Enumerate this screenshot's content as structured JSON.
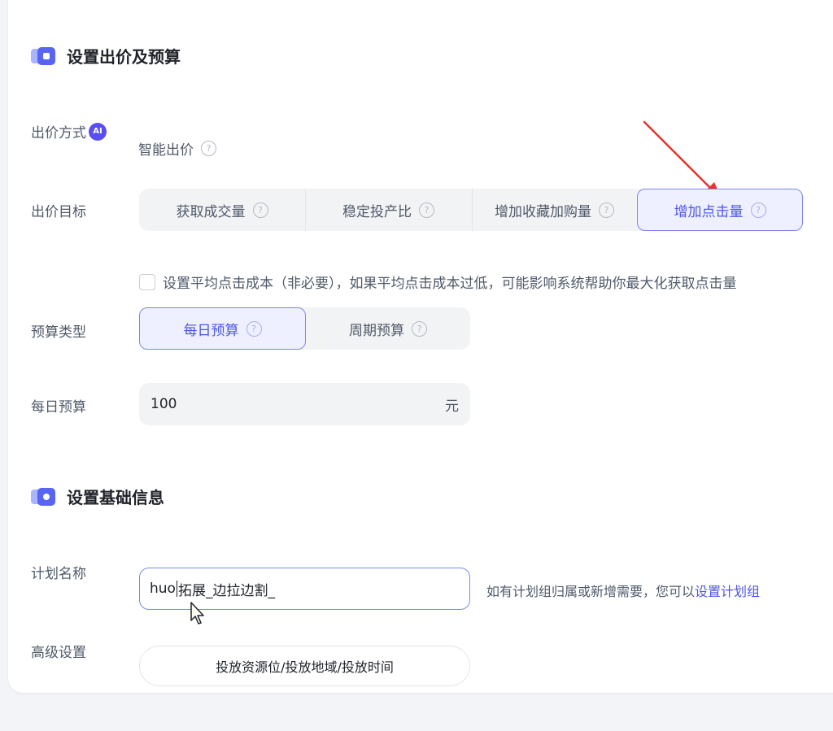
{
  "sections": {
    "bid_budget_title": "设置出价及预算",
    "basic_info_title": "设置基础信息"
  },
  "bid_method": {
    "label": "出价方式",
    "ai_badge": "AI",
    "value": "智能出价"
  },
  "bid_target": {
    "label": "出价目标",
    "options": [
      {
        "label": "获取成交量",
        "active": false
      },
      {
        "label": "稳定投产比",
        "active": false
      },
      {
        "label": "增加收藏加购量",
        "active": false
      },
      {
        "label": "增加点击量",
        "active": true
      }
    ],
    "avg_click_cost_text": "设置平均点击成本（非必要），如果平均点击成本过低，可能影响系统帮助你最大化获取点击量"
  },
  "budget_type": {
    "label": "预算类型",
    "options": [
      {
        "label": "每日预算",
        "active": true
      },
      {
        "label": "周期预算",
        "active": false
      }
    ]
  },
  "daily_budget": {
    "label": "每日预算",
    "value": "100",
    "unit": "元"
  },
  "plan_name": {
    "label": "计划名称",
    "value_before_caret": "huo",
    "value_after_caret": "拓展_边拉边割_",
    "hint": "如有计划组归属或新增需要，您可以",
    "hint_link": "设置计划组"
  },
  "advanced": {
    "label": "高级设置",
    "button_label": "投放资源位/投放地域/投放时间"
  },
  "icons": {
    "help": "?",
    "section_icon": "ticket-icon"
  },
  "colors": {
    "accent": "#4c56e8",
    "annotation_arrow": "#e8322d"
  }
}
